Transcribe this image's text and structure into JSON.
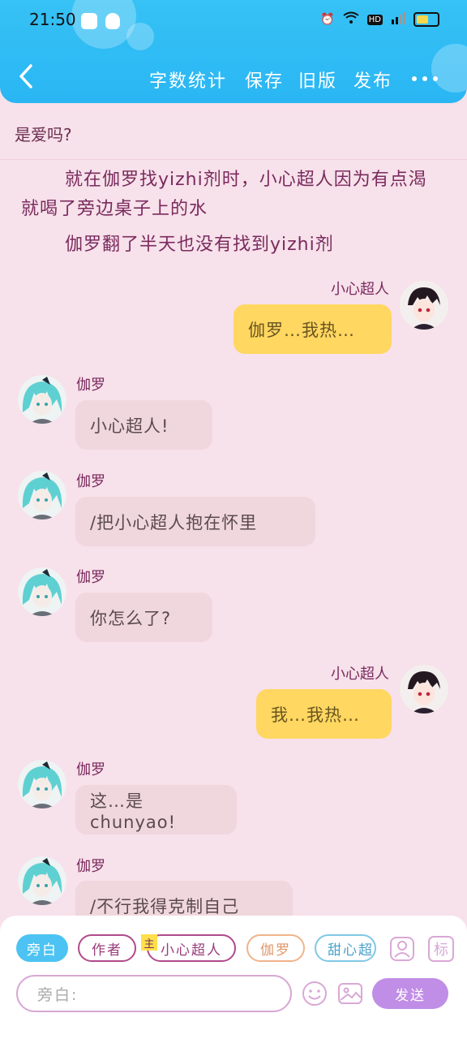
{
  "status_bar": {
    "time": "21:50"
  },
  "header": {
    "nav_items": [
      "字数统计",
      "保存",
      "旧版",
      "发布"
    ]
  },
  "content": {
    "prev_line": "是爱吗?",
    "narration": [
      "就在伽罗找yizhi剂时，小心超人因为有点渴就喝了旁边桌子上的水",
      "伽罗翻了半天也没有找到yizhi剂"
    ],
    "messages": [
      {
        "side": "right",
        "name": "小心超人",
        "text": "伽罗…我热…"
      },
      {
        "side": "left",
        "name": "伽罗",
        "text": "小心超人!"
      },
      {
        "side": "left",
        "name": "伽罗",
        "text": "/把小心超人抱在怀里"
      },
      {
        "side": "left",
        "name": "伽罗",
        "text": "你怎么了?"
      },
      {
        "side": "right",
        "name": "小心超人",
        "text": "我…我热…"
      },
      {
        "side": "left",
        "name": "伽罗",
        "text": "这…是chunyao!"
      },
      {
        "side": "left",
        "name": "伽罗",
        "text": "/不行我得克制自己"
      }
    ]
  },
  "composer": {
    "roles": [
      "旁白",
      "作者",
      "小心超人",
      "伽罗",
      "甜心超"
    ],
    "main_badge": "主",
    "tag_button": "标",
    "input_placeholder": "旁白:",
    "send_label": "发送"
  },
  "colors": {
    "header": "#2ab6f3",
    "background": "#f7e1ea",
    "left_bubble": "#f0d7de",
    "right_bubble": "#ffd761",
    "send_button": "#c08ee6"
  }
}
